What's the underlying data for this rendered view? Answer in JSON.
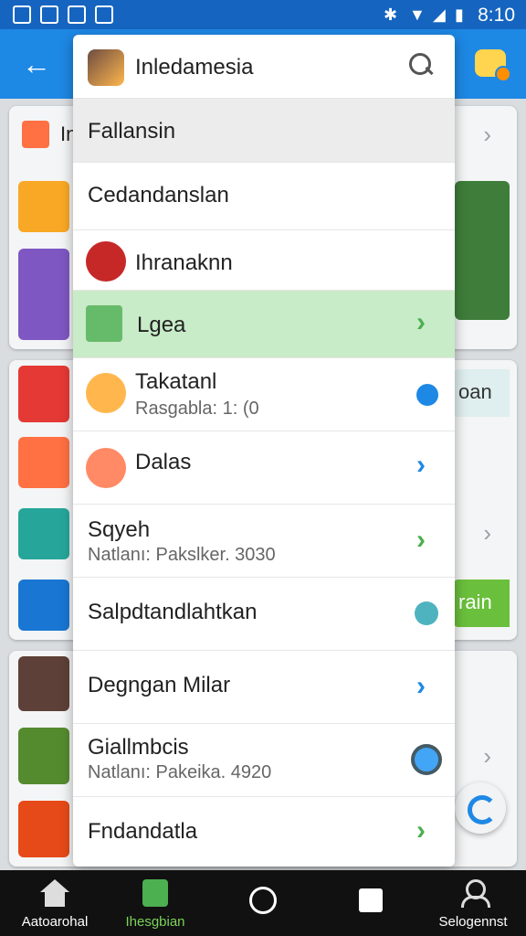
{
  "status_bar": {
    "time": "8:10"
  },
  "dropdown": {
    "title": "Inledamesia",
    "items": [
      {
        "title": "Fallansin",
        "subtitle": "",
        "icon": "none",
        "trailing": "none",
        "highlight": "pressed"
      },
      {
        "title": "Cedandanslan",
        "subtitle": "",
        "icon": "none",
        "trailing": "none",
        "highlight": ""
      },
      {
        "title": "Ihranaknn",
        "subtitle": "",
        "icon": "red-app-icon",
        "trailing": "none",
        "highlight": ""
      },
      {
        "title": "Lgea",
        "subtitle": "",
        "icon": "green-app-icon",
        "trailing": "chevron-green",
        "highlight": "selected"
      },
      {
        "title": "Takatanl",
        "subtitle": "Rasgabla: 1: (0",
        "icon": "character-icon",
        "trailing": "badge-blue",
        "highlight": ""
      },
      {
        "title": "Dalas",
        "subtitle": "",
        "icon": "character-icon",
        "trailing": "chevron-blue",
        "highlight": ""
      },
      {
        "title": "Sqyeh",
        "subtitle": "Natlanı: Pakslker. 3030",
        "icon": "none",
        "trailing": "chevron-green",
        "highlight": ""
      },
      {
        "title": "Salpdtandlahtkan",
        "subtitle": "",
        "icon": "none",
        "trailing": "dot-teal",
        "highlight": ""
      },
      {
        "title": "Degngan Milar",
        "subtitle": "",
        "icon": "none",
        "trailing": "chevron-blue",
        "highlight": ""
      },
      {
        "title": "Giallmbcis",
        "subtitle": "Natlanı: Pakeika. 4920",
        "icon": "none",
        "trailing": "radio-blue",
        "highlight": ""
      },
      {
        "title": "Fndandatla",
        "subtitle": "",
        "icon": "none",
        "trailing": "chevron-green",
        "highlight": ""
      }
    ]
  },
  "background": {
    "row1_letter": "In",
    "button_partial_1": "oan",
    "button_partial_2": "rain"
  },
  "nav": [
    {
      "label": "Aatoarohal",
      "icon": "home-icon",
      "active": false
    },
    {
      "label": "Ihesgbian",
      "icon": "store-icon",
      "active": true
    },
    {
      "label": "",
      "icon": "circle-icon",
      "active": false
    },
    {
      "label": "",
      "icon": "square-icon",
      "active": false
    },
    {
      "label": "Selogennst",
      "icon": "person-icon",
      "active": false
    }
  ],
  "colors": {
    "accent_blue": "#1e88e5",
    "selected_green": "#c8ebc8",
    "chevron_green": "#4caf50",
    "chevron_blue": "#1e88e5"
  }
}
